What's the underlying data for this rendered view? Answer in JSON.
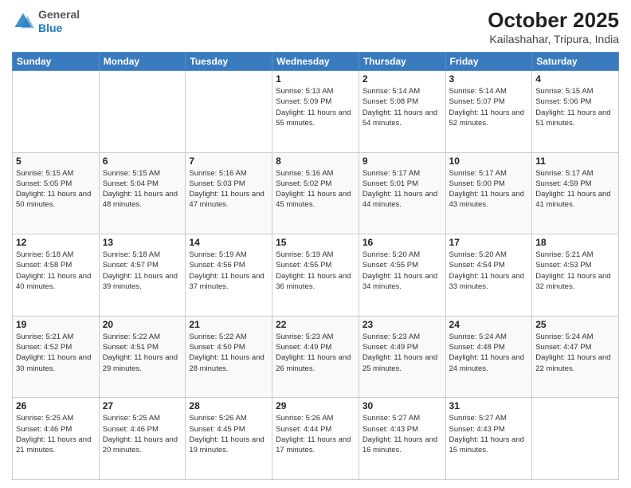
{
  "logo": {
    "general": "General",
    "blue": "Blue"
  },
  "title": "October 2025",
  "subtitle": "Kailashahar, Tripura, India",
  "weekdays": [
    "Sunday",
    "Monday",
    "Tuesday",
    "Wednesday",
    "Thursday",
    "Friday",
    "Saturday"
  ],
  "weeks": [
    [
      {
        "day": "",
        "sunrise": "",
        "sunset": "",
        "daylight": ""
      },
      {
        "day": "",
        "sunrise": "",
        "sunset": "",
        "daylight": ""
      },
      {
        "day": "",
        "sunrise": "",
        "sunset": "",
        "daylight": ""
      },
      {
        "day": "1",
        "sunrise": "Sunrise: 5:13 AM",
        "sunset": "Sunset: 5:09 PM",
        "daylight": "Daylight: 11 hours and 55 minutes."
      },
      {
        "day": "2",
        "sunrise": "Sunrise: 5:14 AM",
        "sunset": "Sunset: 5:08 PM",
        "daylight": "Daylight: 11 hours and 54 minutes."
      },
      {
        "day": "3",
        "sunrise": "Sunrise: 5:14 AM",
        "sunset": "Sunset: 5:07 PM",
        "daylight": "Daylight: 11 hours and 52 minutes."
      },
      {
        "day": "4",
        "sunrise": "Sunrise: 5:15 AM",
        "sunset": "Sunset: 5:06 PM",
        "daylight": "Daylight: 11 hours and 51 minutes."
      }
    ],
    [
      {
        "day": "5",
        "sunrise": "Sunrise: 5:15 AM",
        "sunset": "Sunset: 5:05 PM",
        "daylight": "Daylight: 11 hours and 50 minutes."
      },
      {
        "day": "6",
        "sunrise": "Sunrise: 5:15 AM",
        "sunset": "Sunset: 5:04 PM",
        "daylight": "Daylight: 11 hours and 48 minutes."
      },
      {
        "day": "7",
        "sunrise": "Sunrise: 5:16 AM",
        "sunset": "Sunset: 5:03 PM",
        "daylight": "Daylight: 11 hours and 47 minutes."
      },
      {
        "day": "8",
        "sunrise": "Sunrise: 5:16 AM",
        "sunset": "Sunset: 5:02 PM",
        "daylight": "Daylight: 11 hours and 45 minutes."
      },
      {
        "day": "9",
        "sunrise": "Sunrise: 5:17 AM",
        "sunset": "Sunset: 5:01 PM",
        "daylight": "Daylight: 11 hours and 44 minutes."
      },
      {
        "day": "10",
        "sunrise": "Sunrise: 5:17 AM",
        "sunset": "Sunset: 5:00 PM",
        "daylight": "Daylight: 11 hours and 43 minutes."
      },
      {
        "day": "11",
        "sunrise": "Sunrise: 5:17 AM",
        "sunset": "Sunset: 4:59 PM",
        "daylight": "Daylight: 11 hours and 41 minutes."
      }
    ],
    [
      {
        "day": "12",
        "sunrise": "Sunrise: 5:18 AM",
        "sunset": "Sunset: 4:58 PM",
        "daylight": "Daylight: 11 hours and 40 minutes."
      },
      {
        "day": "13",
        "sunrise": "Sunrise: 5:18 AM",
        "sunset": "Sunset: 4:57 PM",
        "daylight": "Daylight: 11 hours and 39 minutes."
      },
      {
        "day": "14",
        "sunrise": "Sunrise: 5:19 AM",
        "sunset": "Sunset: 4:56 PM",
        "daylight": "Daylight: 11 hours and 37 minutes."
      },
      {
        "day": "15",
        "sunrise": "Sunrise: 5:19 AM",
        "sunset": "Sunset: 4:55 PM",
        "daylight": "Daylight: 11 hours and 36 minutes."
      },
      {
        "day": "16",
        "sunrise": "Sunrise: 5:20 AM",
        "sunset": "Sunset: 4:55 PM",
        "daylight": "Daylight: 11 hours and 34 minutes."
      },
      {
        "day": "17",
        "sunrise": "Sunrise: 5:20 AM",
        "sunset": "Sunset: 4:54 PM",
        "daylight": "Daylight: 11 hours and 33 minutes."
      },
      {
        "day": "18",
        "sunrise": "Sunrise: 5:21 AM",
        "sunset": "Sunset: 4:53 PM",
        "daylight": "Daylight: 11 hours and 32 minutes."
      }
    ],
    [
      {
        "day": "19",
        "sunrise": "Sunrise: 5:21 AM",
        "sunset": "Sunset: 4:52 PM",
        "daylight": "Daylight: 11 hours and 30 minutes."
      },
      {
        "day": "20",
        "sunrise": "Sunrise: 5:22 AM",
        "sunset": "Sunset: 4:51 PM",
        "daylight": "Daylight: 11 hours and 29 minutes."
      },
      {
        "day": "21",
        "sunrise": "Sunrise: 5:22 AM",
        "sunset": "Sunset: 4:50 PM",
        "daylight": "Daylight: 11 hours and 28 minutes."
      },
      {
        "day": "22",
        "sunrise": "Sunrise: 5:23 AM",
        "sunset": "Sunset: 4:49 PM",
        "daylight": "Daylight: 11 hours and 26 minutes."
      },
      {
        "day": "23",
        "sunrise": "Sunrise: 5:23 AM",
        "sunset": "Sunset: 4:49 PM",
        "daylight": "Daylight: 11 hours and 25 minutes."
      },
      {
        "day": "24",
        "sunrise": "Sunrise: 5:24 AM",
        "sunset": "Sunset: 4:48 PM",
        "daylight": "Daylight: 11 hours and 24 minutes."
      },
      {
        "day": "25",
        "sunrise": "Sunrise: 5:24 AM",
        "sunset": "Sunset: 4:47 PM",
        "daylight": "Daylight: 11 hours and 22 minutes."
      }
    ],
    [
      {
        "day": "26",
        "sunrise": "Sunrise: 5:25 AM",
        "sunset": "Sunset: 4:46 PM",
        "daylight": "Daylight: 11 hours and 21 minutes."
      },
      {
        "day": "27",
        "sunrise": "Sunrise: 5:25 AM",
        "sunset": "Sunset: 4:46 PM",
        "daylight": "Daylight: 11 hours and 20 minutes."
      },
      {
        "day": "28",
        "sunrise": "Sunrise: 5:26 AM",
        "sunset": "Sunset: 4:45 PM",
        "daylight": "Daylight: 11 hours and 19 minutes."
      },
      {
        "day": "29",
        "sunrise": "Sunrise: 5:26 AM",
        "sunset": "Sunset: 4:44 PM",
        "daylight": "Daylight: 11 hours and 17 minutes."
      },
      {
        "day": "30",
        "sunrise": "Sunrise: 5:27 AM",
        "sunset": "Sunset: 4:43 PM",
        "daylight": "Daylight: 11 hours and 16 minutes."
      },
      {
        "day": "31",
        "sunrise": "Sunrise: 5:27 AM",
        "sunset": "Sunset: 4:43 PM",
        "daylight": "Daylight: 11 hours and 15 minutes."
      },
      {
        "day": "",
        "sunrise": "",
        "sunset": "",
        "daylight": ""
      }
    ]
  ]
}
